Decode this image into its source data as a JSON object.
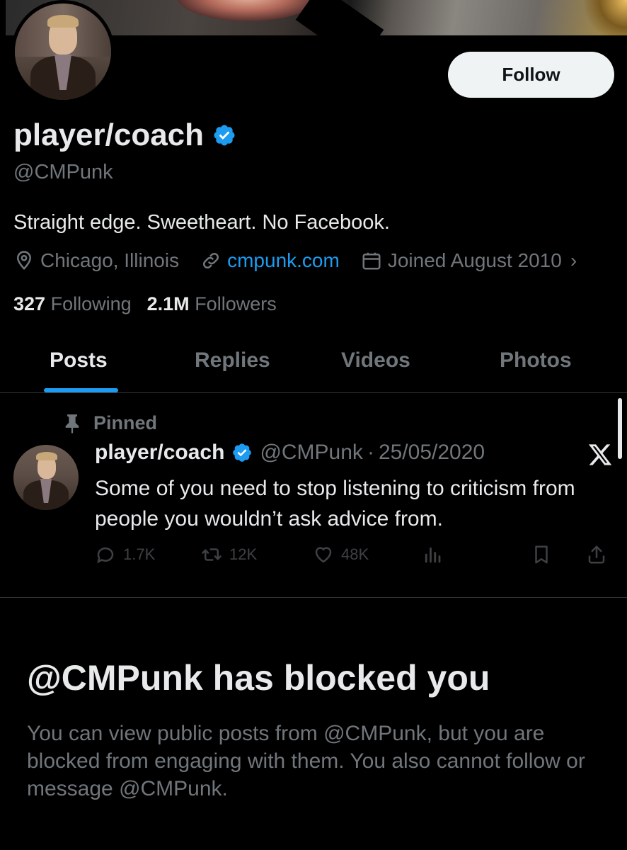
{
  "profile": {
    "display_name": "player/coach",
    "handle": "@CMPunk",
    "bio": "Straight edge. Sweetheart. No Facebook.",
    "location": "Chicago, Illinois",
    "website": "cmpunk.com",
    "joined": "Joined August 2010",
    "following_count": "327",
    "following_label": "Following",
    "followers_count": "2.1M",
    "followers_label": "Followers",
    "follow_button": "Follow"
  },
  "tabs": [
    {
      "label": "Posts",
      "active": true
    },
    {
      "label": "Replies",
      "active": false
    },
    {
      "label": "Videos",
      "active": false
    },
    {
      "label": "Photos",
      "active": false
    }
  ],
  "pinned_post": {
    "pinned_label": "Pinned",
    "author_name": "player/coach",
    "author_handle": "@CMPunk",
    "separator": "·",
    "date": "25/05/2020",
    "text": "Some of you need to stop listening to criticism from people you wouldn’t ask advice from.",
    "replies": "1.7K",
    "reposts": "12K",
    "likes": "48K"
  },
  "blocked": {
    "title": "@CMPunk has blocked you",
    "message": "You can view public posts from @CMPunk, but you are blocked from engaging with them. You also cannot follow or message @CMPunk."
  },
  "colors": {
    "accent": "#1d9bf0",
    "background": "#000000",
    "text_primary": "#e7e9ea",
    "text_secondary": "#71767b"
  },
  "icons": [
    "verified-badge-icon",
    "location-pin-icon",
    "link-icon",
    "calendar-icon",
    "chevron-right-icon",
    "pin-icon",
    "x-logo-icon",
    "reply-icon",
    "repost-icon",
    "like-icon",
    "views-icon",
    "bookmark-icon",
    "share-icon"
  ]
}
